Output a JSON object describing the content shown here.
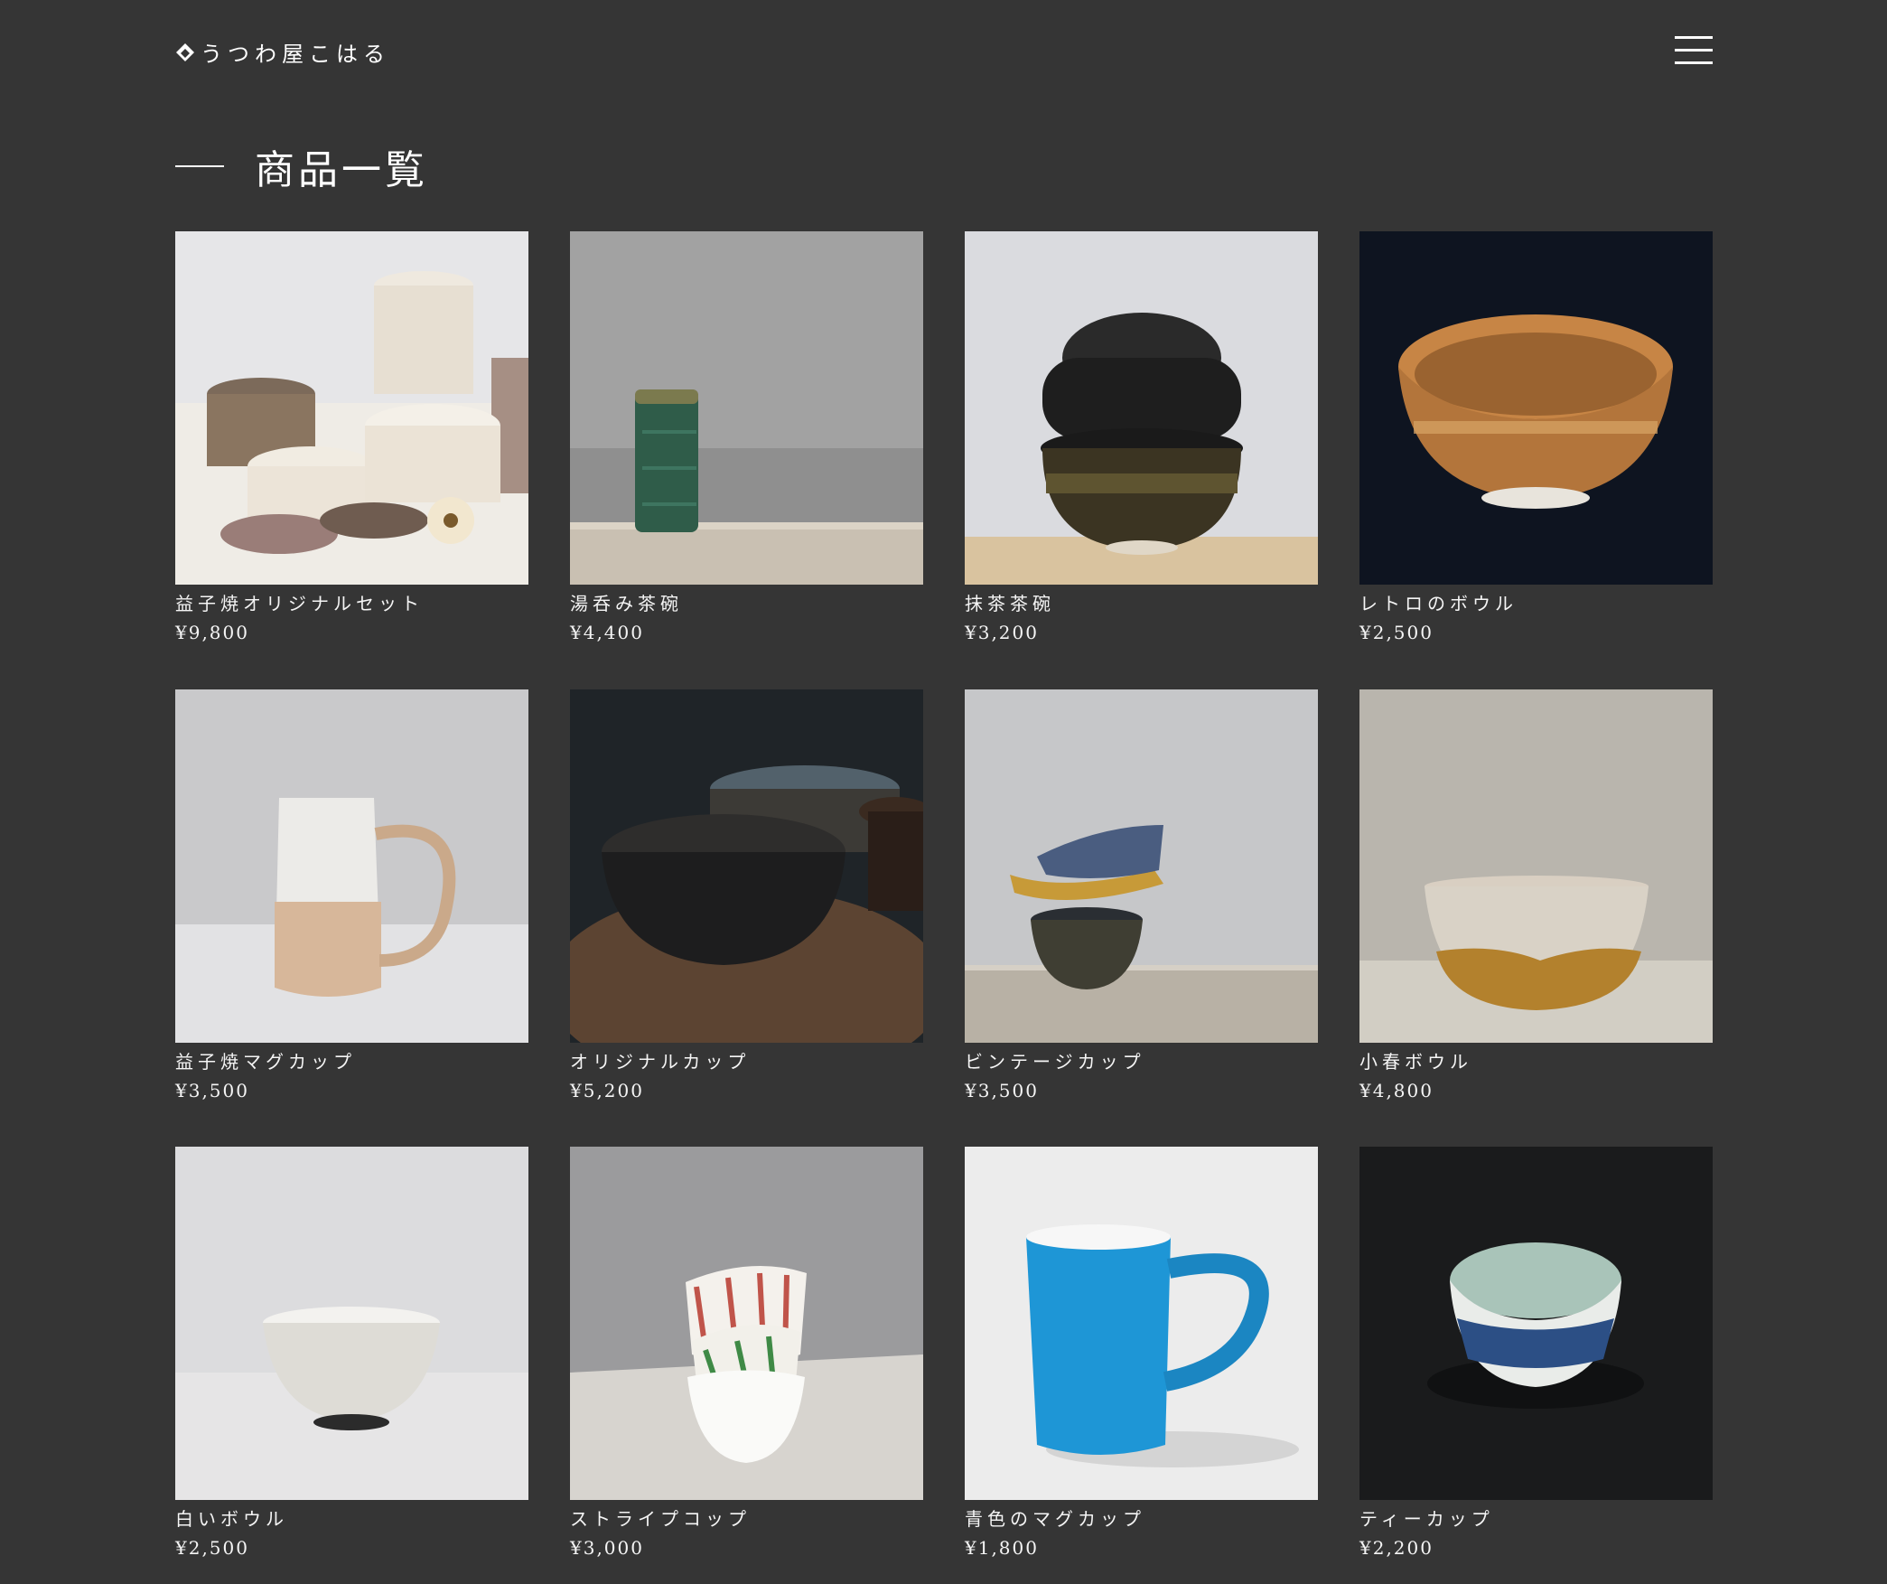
{
  "header": {
    "logo_text": "うつわ屋こはる",
    "logo_icon": "diamond-logo-icon",
    "menu_icon": "hamburger-menu-icon"
  },
  "page": {
    "title": "商品一覧"
  },
  "products": [
    {
      "name": "益子焼オリジナルセット",
      "price": "¥9,800"
    },
    {
      "name": "湯呑み茶碗",
      "price": "¥4,400"
    },
    {
      "name": "抹茶茶碗",
      "price": "¥3,200"
    },
    {
      "name": "レトロのボウル",
      "price": "¥2,500"
    },
    {
      "name": "益子焼マグカップ",
      "price": "¥3,500"
    },
    {
      "name": "オリジナルカップ",
      "price": "¥5,200"
    },
    {
      "name": "ビンテージカップ",
      "price": "¥3,500"
    },
    {
      "name": "小春ボウル",
      "price": "¥4,800"
    },
    {
      "name": "白いボウル",
      "price": "¥2,500"
    },
    {
      "name": "ストライプコップ",
      "price": "¥3,000"
    },
    {
      "name": "青色のマグカップ",
      "price": "¥1,800"
    },
    {
      "name": "ティーカップ",
      "price": "¥2,200"
    }
  ],
  "colors": {
    "background": "#353535",
    "text": "#ffffff"
  }
}
